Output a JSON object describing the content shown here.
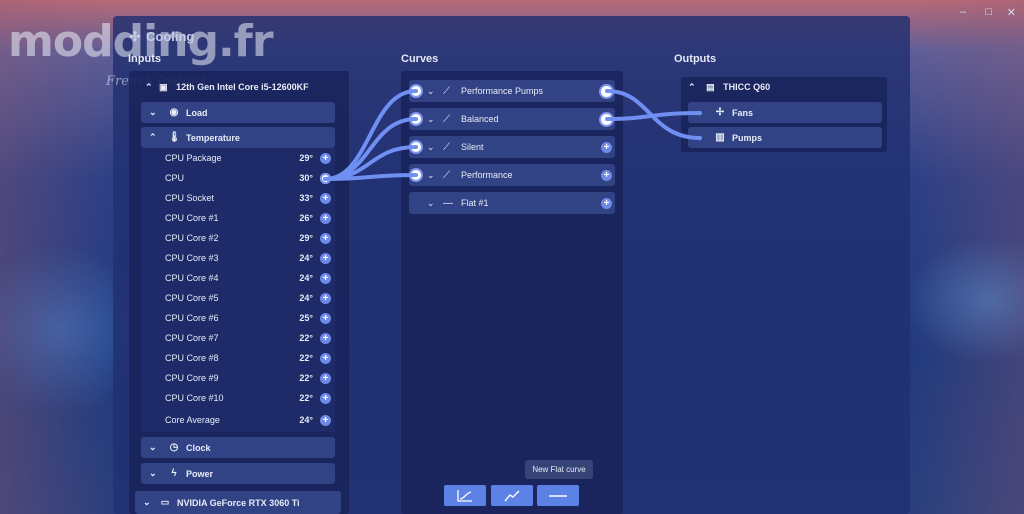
{
  "app": {
    "title": "Cooling",
    "watermark": "modding.fr",
    "watermark_sub": "French Instinct"
  },
  "window_controls": {
    "minimize": "–",
    "maximize": "□",
    "close": "✕"
  },
  "columns": {
    "inputs": "Inputs",
    "curves": "Curves",
    "outputs": "Outputs"
  },
  "inputs": {
    "device": "12th Gen Intel Core i5-12600KF",
    "groups": {
      "load": "Load",
      "temperature": "Temperature",
      "clock": "Clock",
      "power": "Power"
    },
    "sensors": [
      {
        "name": "CPU Package",
        "value": "29°"
      },
      {
        "name": "CPU",
        "value": "30°"
      },
      {
        "name": "CPU Socket",
        "value": "33°"
      },
      {
        "name": "CPU Core #1",
        "value": "26°"
      },
      {
        "name": "CPU Core #2",
        "value": "29°"
      },
      {
        "name": "CPU Core #3",
        "value": "24°"
      },
      {
        "name": "CPU Core #4",
        "value": "24°"
      },
      {
        "name": "CPU Core #5",
        "value": "24°"
      },
      {
        "name": "CPU Core #6",
        "value": "25°"
      },
      {
        "name": "CPU Core #7",
        "value": "22°"
      },
      {
        "name": "CPU Core #8",
        "value": "22°"
      },
      {
        "name": "CPU Core #9",
        "value": "22°"
      },
      {
        "name": "CPU Core #10",
        "value": "22°"
      },
      {
        "name": "Core Average",
        "value": "24°"
      }
    ],
    "gpu": "NVIDIA GeForce RTX 3060 Ti"
  },
  "curves": [
    {
      "name": "Performance Pumps"
    },
    {
      "name": "Balanced"
    },
    {
      "name": "Silent"
    },
    {
      "name": "Performance"
    },
    {
      "name": "Flat #1"
    }
  ],
  "outputs": {
    "device": "THICC Q60",
    "items": [
      {
        "name": "Fans"
      },
      {
        "name": "Pumps"
      }
    ]
  },
  "toolbar": {
    "tooltip": "New Flat curve"
  },
  "colors": {
    "accent": "#5d82e6",
    "wire": "#6f8ff2",
    "panel": "#19245c"
  }
}
